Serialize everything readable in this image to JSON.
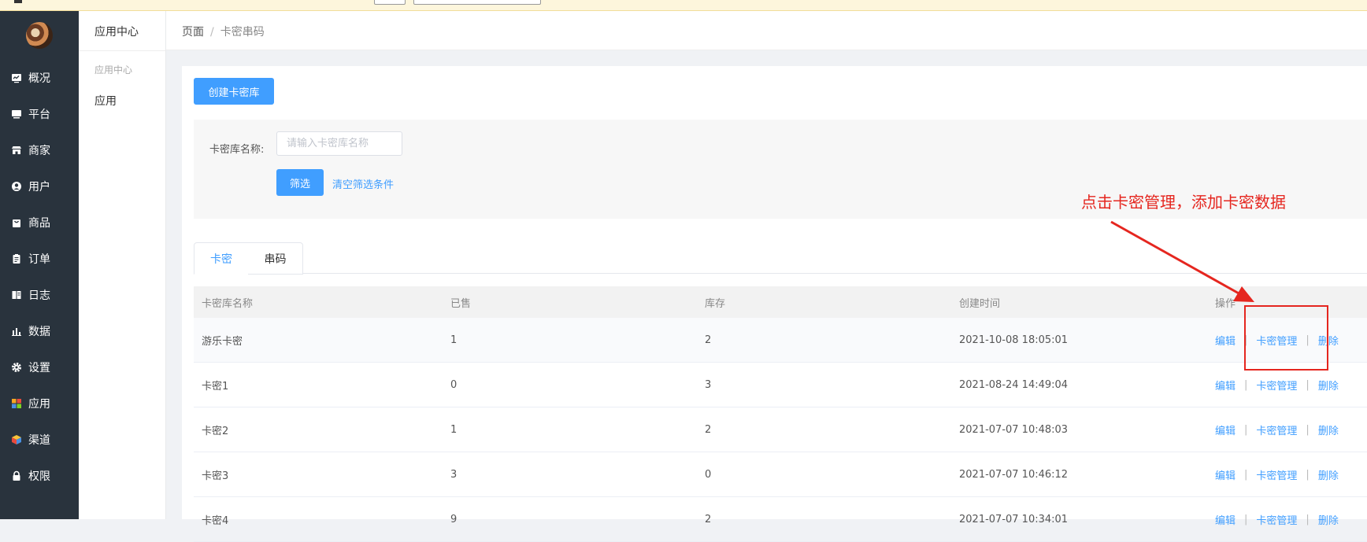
{
  "sidebar": {
    "items": [
      {
        "label": "概况",
        "icon": "monitor-chart-icon"
      },
      {
        "label": "平台",
        "icon": "desktop-icon"
      },
      {
        "label": "商家",
        "icon": "store-icon"
      },
      {
        "label": "用户",
        "icon": "user-icon"
      },
      {
        "label": "商品",
        "icon": "shopping-bag-icon"
      },
      {
        "label": "订单",
        "icon": "clipboard-icon"
      },
      {
        "label": "日志",
        "icon": "log-book-icon"
      },
      {
        "label": "数据",
        "icon": "bar-chart-icon"
      },
      {
        "label": "设置",
        "icon": "gear-icon"
      },
      {
        "label": "应用",
        "icon": "app-grid-icon"
      },
      {
        "label": "渠道",
        "icon": "cube-icon"
      },
      {
        "label": "权限",
        "icon": "lock-icon"
      }
    ]
  },
  "subnav": {
    "title": "应用中心",
    "group_label": "应用中心",
    "item_label": "应用"
  },
  "breadcrumb": {
    "parent": "页面",
    "separator": "/",
    "current": "卡密串码"
  },
  "toolbar": {
    "create_label": "创建卡密库"
  },
  "filter": {
    "name_label": "卡密库名称:",
    "name_placeholder": "请输入卡密库名称",
    "name_value": "",
    "submit_label": "筛选",
    "clear_label": "清空筛选条件"
  },
  "tabs": [
    {
      "label": "卡密",
      "active": true
    },
    {
      "label": "串码",
      "active": false
    }
  ],
  "table": {
    "columns": [
      "卡密库名称",
      "已售",
      "库存",
      "创建时间",
      "操作"
    ],
    "rows": [
      {
        "name": "游乐卡密",
        "sold": "1",
        "stock": "2",
        "created": "2021-10-08 18:05:01"
      },
      {
        "name": "卡密1",
        "sold": "0",
        "stock": "3",
        "created": "2021-08-24 14:49:04"
      },
      {
        "name": "卡密2",
        "sold": "1",
        "stock": "2",
        "created": "2021-07-07 10:48:03"
      },
      {
        "name": "卡密3",
        "sold": "3",
        "stock": "0",
        "created": "2021-07-07 10:46:12"
      },
      {
        "name": "卡密4",
        "sold": "9",
        "stock": "2",
        "created": "2021-07-07 10:34:01"
      }
    ],
    "actions": {
      "edit": "编辑",
      "manage": "卡密管理",
      "delete": "删除",
      "separator": "|"
    }
  },
  "annotation": {
    "text": "点击卡密管理，添加卡密数据",
    "color": "#e5261f"
  },
  "colors": {
    "primary": "#409eff",
    "sidebar": "#29333d"
  }
}
